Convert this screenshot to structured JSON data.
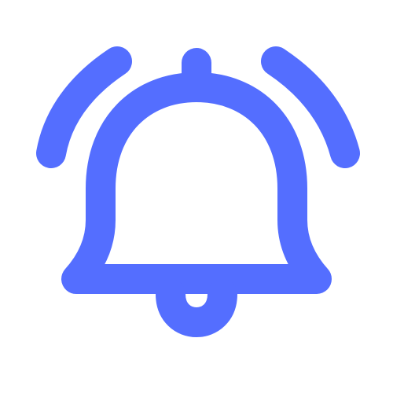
{
  "icon": {
    "name": "notification-bell-icon",
    "stroke_color": "#546EFF",
    "background_color": "#FFFFFF",
    "ringing": true
  }
}
